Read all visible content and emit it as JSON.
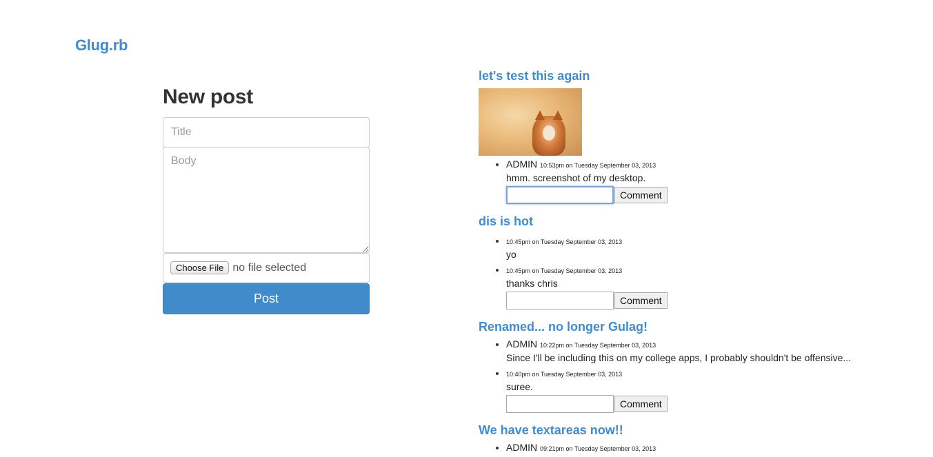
{
  "brand": "Glug.rb",
  "new_post": {
    "heading": "New post",
    "title_placeholder": "Title",
    "body_placeholder": "Body",
    "file_button_label": "Choose File",
    "file_status": "no file selected",
    "submit_label": "Post"
  },
  "comment_button_label": "Comment",
  "posts": [
    {
      "title": "let's test this again",
      "comments": [
        {
          "author": "ADMIN",
          "time": "10:53pm on Tuesday September 03, 2013",
          "text": "hmm. screenshot of my desktop."
        }
      ]
    },
    {
      "title": "dis is hot",
      "comments": [
        {
          "author": "",
          "time": "10:45pm on Tuesday September 03, 2013",
          "text": "yo"
        },
        {
          "author": "",
          "time": "10:45pm on Tuesday September 03, 2013",
          "text": "thanks chris"
        }
      ]
    },
    {
      "title": "Renamed... no longer Gulag!",
      "comments": [
        {
          "author": "ADMIN",
          "time": "10:22pm on Tuesday September 03, 2013",
          "text": "Since I'll be including this on my college apps, I probably shouldn't be offensive..."
        },
        {
          "author": "",
          "time": "10:40pm on Tuesday September 03, 2013",
          "text": "suree."
        }
      ]
    },
    {
      "title": "We have textareas now!!",
      "comments": [
        {
          "author": "ADMIN",
          "time": "09:21pm on Tuesday September 03, 2013",
          "text": ""
        }
      ]
    }
  ]
}
